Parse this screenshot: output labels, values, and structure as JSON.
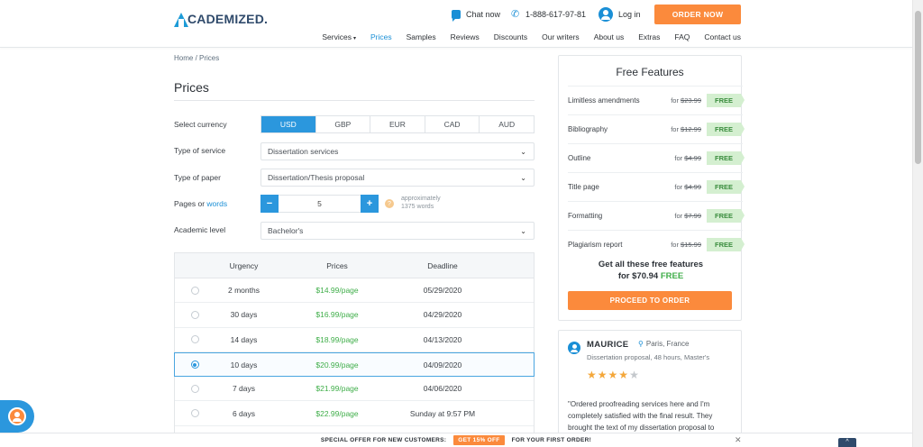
{
  "header": {
    "logo_text": "CADEMIZED.",
    "chat_label": "Chat now",
    "phone": "1-888-617-97-81",
    "login_label": "Log in",
    "order_label": "ORDER NOW",
    "nav": [
      {
        "label": "Services",
        "caret": "▾"
      },
      {
        "label": "Prices"
      },
      {
        "label": "Samples"
      },
      {
        "label": "Reviews"
      },
      {
        "label": "Discounts"
      },
      {
        "label": "Our writers"
      },
      {
        "label": "About us"
      },
      {
        "label": "Extras"
      },
      {
        "label": "FAQ"
      },
      {
        "label": "Contact us"
      }
    ],
    "active_nav": "Prices"
  },
  "breadcrumb": "Home / Prices",
  "page_title": "Prices",
  "form": {
    "currency_label": "Select currency",
    "currencies": [
      "USD",
      "GBP",
      "EUR",
      "CAD",
      "AUD"
    ],
    "selected_currency": "USD",
    "service_label": "Type of service",
    "service_value": "Dissertation services",
    "paper_label": "Type of paper",
    "paper_value": "Dissertation/Thesis proposal",
    "pages_label": "Pages or",
    "words_link": "words",
    "pages_value": "5",
    "minus": "−",
    "plus": "+",
    "help": "?",
    "approx_line1": "approximately",
    "approx_line2": "1375 words",
    "level_label": "Academic level",
    "level_value": "Bachelor's",
    "chevron": "⌄"
  },
  "urgency_table": {
    "headers": {
      "urgency": "Urgency",
      "prices": "Prices",
      "deadline": "Deadline"
    },
    "rows": [
      {
        "urgency": "2 months",
        "price": "$14.99/page",
        "deadline": "05/29/2020",
        "selected": false
      },
      {
        "urgency": "30 days",
        "price": "$16.99/page",
        "deadline": "04/29/2020",
        "selected": false
      },
      {
        "urgency": "14 days",
        "price": "$18.99/page",
        "deadline": "04/13/2020",
        "selected": false
      },
      {
        "urgency": "10 days",
        "price": "$20.99/page",
        "deadline": "04/09/2020",
        "selected": true
      },
      {
        "urgency": "7 days",
        "price": "$21.99/page",
        "deadline": "04/06/2020",
        "selected": false
      },
      {
        "urgency": "6 days",
        "price": "$22.99/page",
        "deadline": "Sunday at 9:57 PM",
        "selected": false
      }
    ]
  },
  "features": {
    "title": "Free Features",
    "for_word": "for",
    "free_label": "FREE",
    "items": [
      {
        "name": "Limitless amendments",
        "price": "$23.99"
      },
      {
        "name": "Bibliography",
        "price": "$12.99"
      },
      {
        "name": "Outline",
        "price": "$4.99"
      },
      {
        "name": "Title page",
        "price": "$4.99"
      },
      {
        "name": "Formatting",
        "price": "$7.99"
      },
      {
        "name": "Plagiarism report",
        "price": "$15.99"
      }
    ],
    "total_line1": "Get all these free features",
    "total_for": "for",
    "total_amount": "$70.94",
    "total_free": "FREE",
    "proceed_label": "PROCEED TO ORDER"
  },
  "review": {
    "name": "MAURICE",
    "location": "Paris, France",
    "meta": "Dissertation proposal, 48 hours, Master's",
    "rating": 4,
    "rating_max": 5,
    "text": "\"Ordered proofreading services here and I'm completely satisfied with the final result. They brought the text of my dissertation proposal to"
  },
  "offer_banner": {
    "left": "SPECIAL OFFER FOR NEW CUSTOMERS:",
    "badge": "GET 15% OFF",
    "right": "FOR YOUR FIRST ORDER!",
    "close": "✕"
  },
  "scroll_top": "^",
  "colors": {
    "brand_blue": "#1a8fd6",
    "accent_orange": "#fb8a3c",
    "price_green": "#3fae49"
  }
}
